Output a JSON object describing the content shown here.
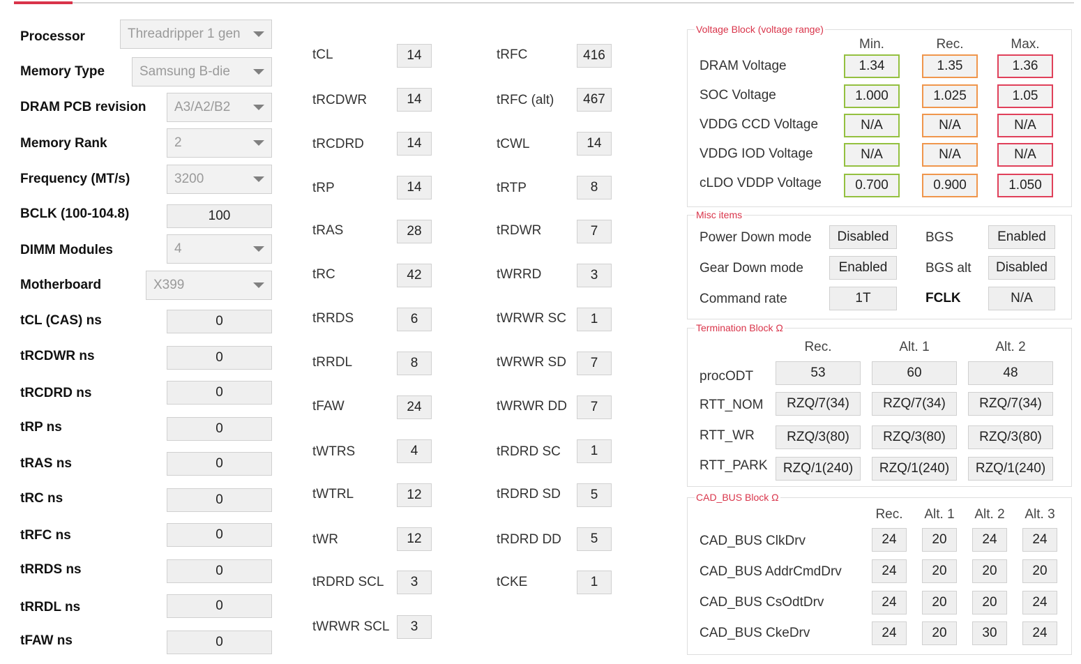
{
  "left": {
    "processor": {
      "label": "Processor",
      "value": "Threadripper 1 gen"
    },
    "memory_type": {
      "label": "Memory Type",
      "value": "Samsung B-die"
    },
    "pcb_revision": {
      "label": "DRAM PCB revision",
      "value": "A3/A2/B2"
    },
    "memory_rank": {
      "label": "Memory Rank",
      "value": "2"
    },
    "frequency": {
      "label": "Frequency (MT/s)",
      "value": "3200"
    },
    "bclk": {
      "label": "BCLK (100-104.8)",
      "value": "100"
    },
    "dimm_modules": {
      "label": "DIMM Modules",
      "value": "4"
    },
    "motherboard": {
      "label": "Motherboard",
      "value": "X399"
    },
    "ns_fields": [
      {
        "label": "tCL (CAS) ns",
        "value": "0"
      },
      {
        "label": "tRCDWR ns",
        "value": "0"
      },
      {
        "label": "tRCDRD ns",
        "value": "0"
      },
      {
        "label": "tRP ns",
        "value": "0"
      },
      {
        "label": "tRAS ns",
        "value": "0"
      },
      {
        "label": "tRC ns",
        "value": "0"
      },
      {
        "label": "tRFC ns",
        "value": "0"
      },
      {
        "label": "tRRDS ns",
        "value": "0"
      },
      {
        "label": "tRRDL ns",
        "value": "0"
      },
      {
        "label": "tFAW ns",
        "value": "0"
      }
    ]
  },
  "timings_col1": [
    {
      "label": "tCL",
      "value": "14"
    },
    {
      "label": "tRCDWR",
      "value": "14"
    },
    {
      "label": "tRCDRD",
      "value": "14"
    },
    {
      "label": "tRP",
      "value": "14"
    },
    {
      "label": "tRAS",
      "value": "28"
    },
    {
      "label": "tRC",
      "value": "42"
    },
    {
      "label": "tRRDS",
      "value": "6"
    },
    {
      "label": "tRRDL",
      "value": "8"
    },
    {
      "label": "tFAW",
      "value": "24"
    },
    {
      "label": "tWTRS",
      "value": "4"
    },
    {
      "label": "tWTRL",
      "value": "12"
    },
    {
      "label": "tWR",
      "value": "12"
    },
    {
      "label": "tRDRD SCL",
      "value": "3"
    },
    {
      "label": "tWRWR SCL",
      "value": "3"
    }
  ],
  "timings_col2": [
    {
      "label": "tRFC",
      "value": "416"
    },
    {
      "label": "tRFC (alt)",
      "value": "467"
    },
    {
      "label": "tCWL",
      "value": "14"
    },
    {
      "label": "tRTP",
      "value": "8"
    },
    {
      "label": "tRDWR",
      "value": "7"
    },
    {
      "label": "tWRRD",
      "value": "3"
    },
    {
      "label": "tWRWR SC",
      "value": "1"
    },
    {
      "label": "tWRWR SD",
      "value": "7"
    },
    {
      "label": "tWRWR DD",
      "value": "7"
    },
    {
      "label": "tRDRD SC",
      "value": "1"
    },
    {
      "label": "tRDRD SD",
      "value": "5"
    },
    {
      "label": "tRDRD DD",
      "value": "5"
    },
    {
      "label": "tCKE",
      "value": "1"
    }
  ],
  "voltage": {
    "title": "Voltage Block (voltage range)",
    "headers": [
      "Min.",
      "Rec.",
      "Max."
    ],
    "rows": [
      {
        "label": "DRAM Voltage",
        "min": "1.34",
        "rec": "1.35",
        "max": "1.36"
      },
      {
        "label": "SOC Voltage",
        "min": "1.000",
        "rec": "1.025",
        "max": "1.05"
      },
      {
        "label": "VDDG  CCD Voltage",
        "min": "N/A",
        "rec": "N/A",
        "max": "N/A"
      },
      {
        "label": "VDDG  IOD Voltage",
        "min": "N/A",
        "rec": "N/A",
        "max": "N/A"
      },
      {
        "label": "cLDO VDDP Voltage",
        "min": "0.700",
        "rec": "0.900",
        "max": "1.050"
      }
    ],
    "colors": {
      "min": "#94c040",
      "rec": "#f0964c",
      "max": "#e0405a"
    }
  },
  "misc": {
    "title": "Misc items",
    "power_down": {
      "label": "Power Down mode",
      "value": "Disabled"
    },
    "bgs": {
      "label": "BGS",
      "value": "Enabled"
    },
    "gear_down": {
      "label": "Gear Down mode",
      "value": "Enabled"
    },
    "bgs_alt": {
      "label": "BGS alt",
      "value": "Disabled"
    },
    "command_rate": {
      "label": "Command rate",
      "value": "1T"
    },
    "fclk": {
      "label": "FCLK",
      "value": "N/A"
    }
  },
  "termination": {
    "title": "Termination Block Ω",
    "headers": [
      "Rec.",
      "Alt. 1",
      "Alt. 2"
    ],
    "rows": [
      {
        "label": "procODT",
        "values": [
          "53",
          "60",
          "48"
        ]
      },
      {
        "label": "RTT_NOM",
        "values": [
          "RZQ/7(34)",
          "RZQ/7(34)",
          "RZQ/7(34)"
        ]
      },
      {
        "label": "RTT_WR",
        "values": [
          "RZQ/3(80)",
          "RZQ/3(80)",
          "RZQ/3(80)"
        ]
      },
      {
        "label": "RTT_PARK",
        "values": [
          "RZQ/1(240)",
          "RZQ/1(240)",
          "RZQ/1(240)"
        ]
      }
    ]
  },
  "cadbus": {
    "title": "CAD_BUS Block Ω",
    "headers": [
      "Rec.",
      "Alt. 1",
      "Alt. 2",
      "Alt. 3"
    ],
    "rows": [
      {
        "label": "CAD_BUS ClkDrv",
        "values": [
          "24",
          "20",
          "24",
          "24"
        ]
      },
      {
        "label": "CAD_BUS AddrCmdDrv",
        "values": [
          "24",
          "20",
          "20",
          "20"
        ]
      },
      {
        "label": "CAD_BUS CsOdtDrv",
        "values": [
          "24",
          "20",
          "20",
          "24"
        ]
      },
      {
        "label": "CAD_BUS CkeDrv",
        "values": [
          "24",
          "20",
          "30",
          "24"
        ]
      }
    ]
  },
  "accent_color": "#d9344a"
}
